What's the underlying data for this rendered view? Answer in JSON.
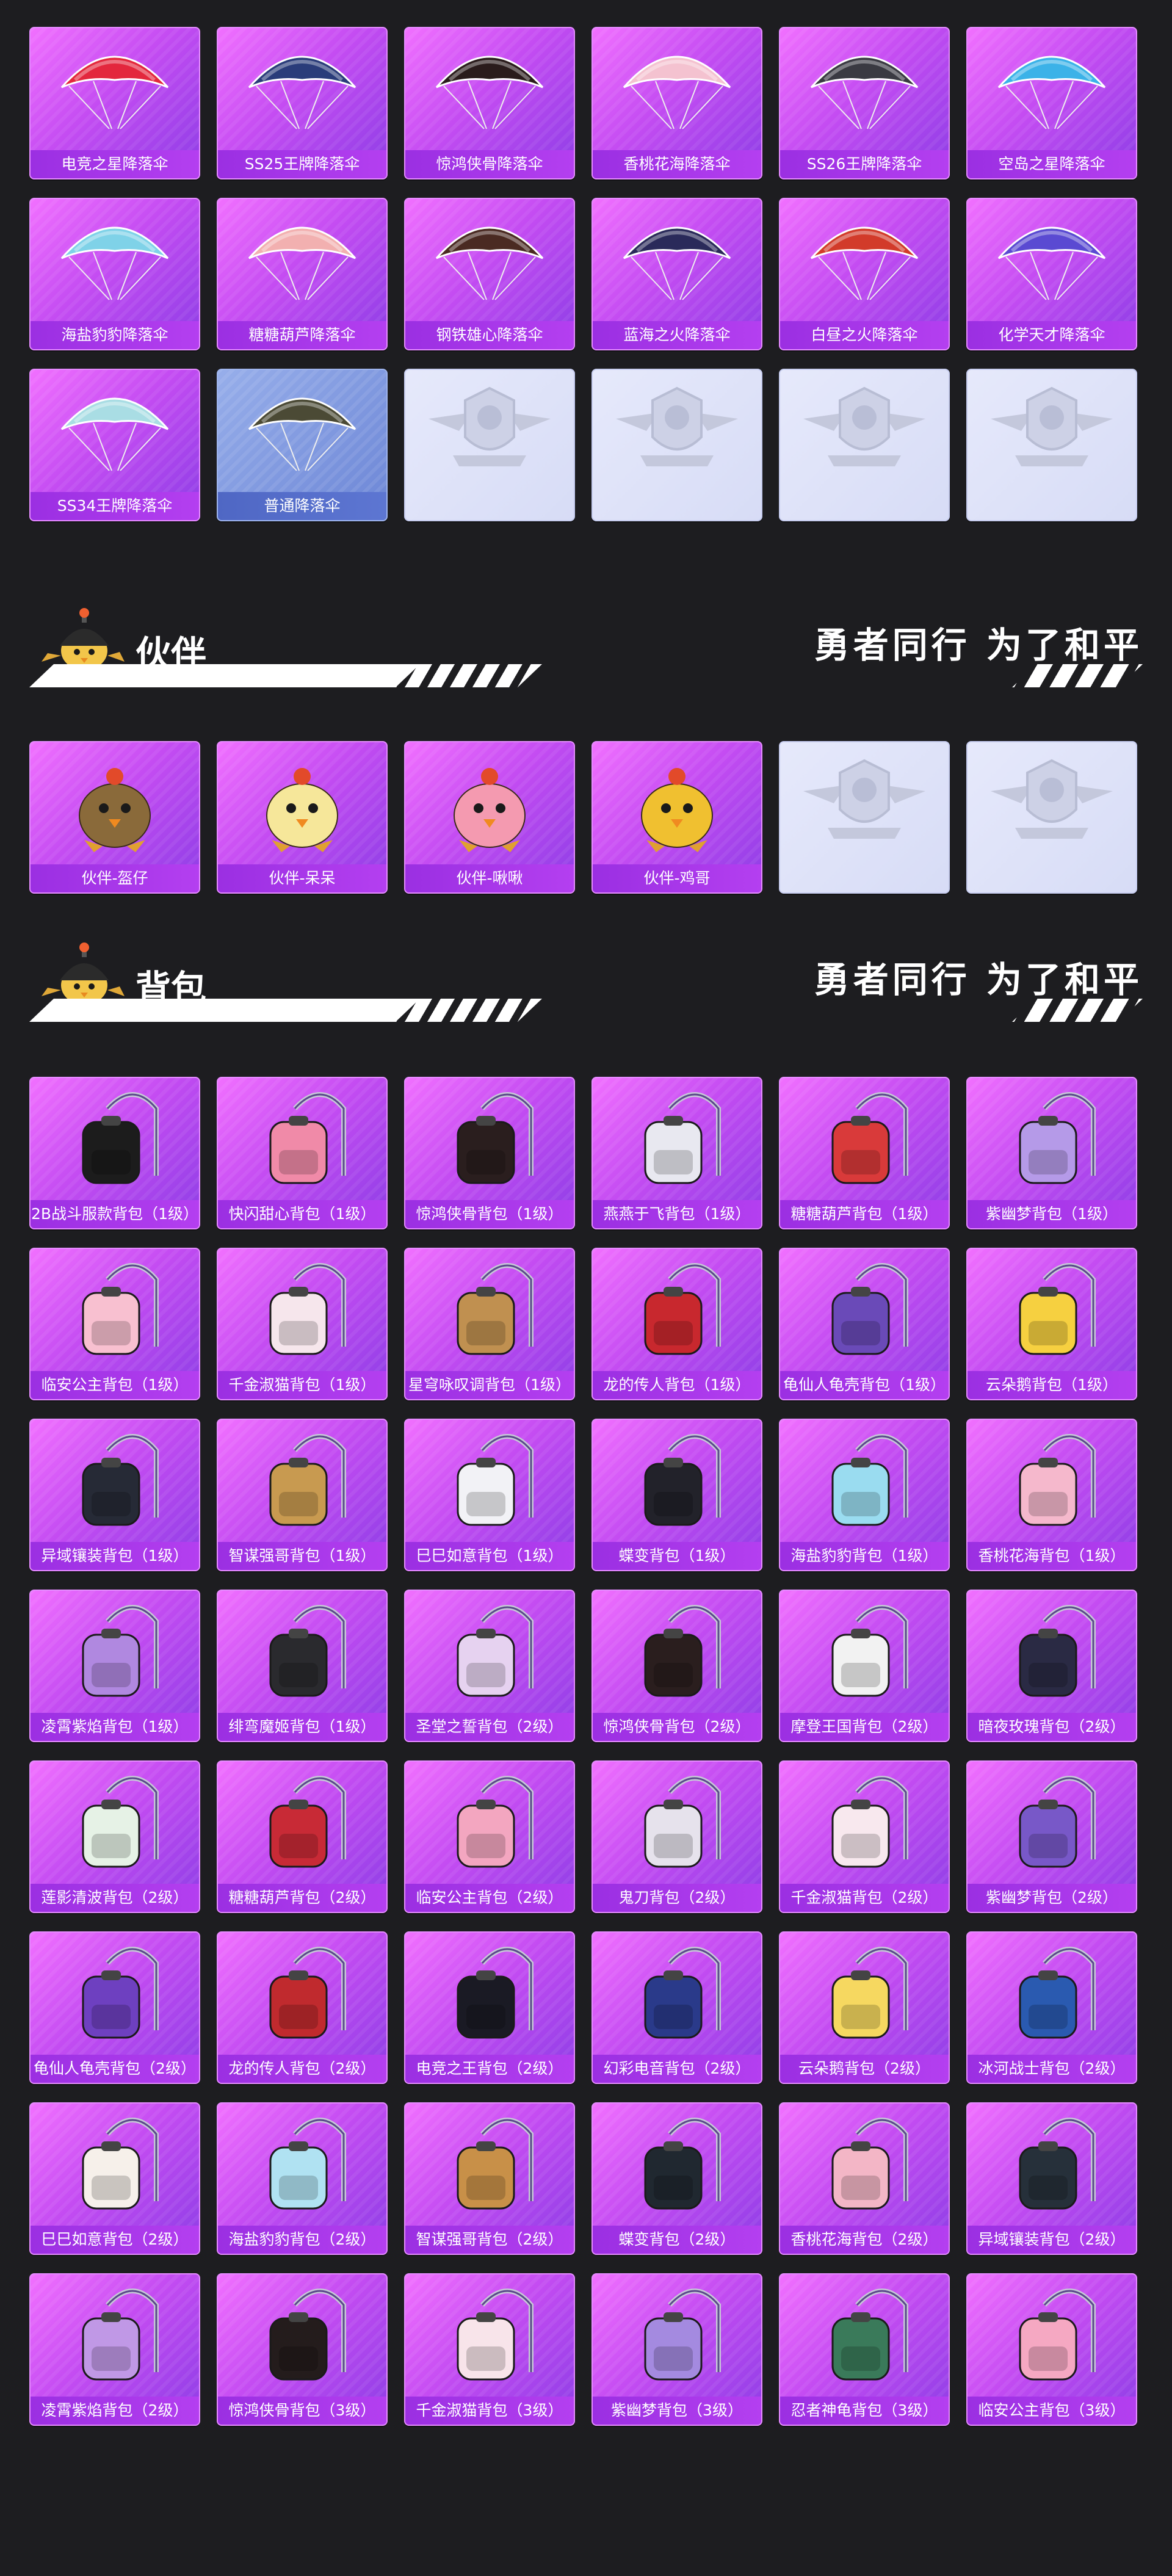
{
  "parachutes": {
    "items": [
      {
        "label": "电竞之星降落伞",
        "icon": "parachute-icon",
        "color": "#e3273d"
      },
      {
        "label": "SS25王牌降落伞",
        "icon": "parachute-icon",
        "color": "#2a3c7a"
      },
      {
        "label": "惊鸿侠骨降落伞",
        "icon": "parachute-icon",
        "color": "#2a1c1c"
      },
      {
        "label": "香桃花海降落伞",
        "icon": "parachute-icon",
        "color": "#f4c2d0"
      },
      {
        "label": "SS26王牌降落伞",
        "icon": "parachute-icon",
        "color": "#3a3a42"
      },
      {
        "label": "空岛之星降落伞",
        "icon": "parachute-icon",
        "color": "#3bb2e8"
      },
      {
        "label": "海盐豹豹降落伞",
        "icon": "parachute-icon",
        "color": "#7fd2e8"
      },
      {
        "label": "糖糖葫芦降落伞",
        "icon": "parachute-icon",
        "color": "#f2b0b0"
      },
      {
        "label": "钢铁雄心降落伞",
        "icon": "parachute-icon",
        "color": "#4a2a22"
      },
      {
        "label": "蓝海之火降落伞",
        "icon": "parachute-icon",
        "color": "#2a2a5a"
      },
      {
        "label": "白昼之火降落伞",
        "icon": "parachute-icon",
        "color": "#d23b2a"
      },
      {
        "label": "化学天才降落伞",
        "icon": "parachute-icon",
        "color": "#5a4ad2"
      },
      {
        "label": "SS34王牌降落伞",
        "icon": "parachute-icon",
        "color": "#a9dde4"
      },
      {
        "label": "普通降落伞",
        "icon": "parachute-icon",
        "color": "#4b4a35",
        "variant": "blue"
      },
      {
        "label": "",
        "icon": "pubg-emblem-icon",
        "variant": "empty"
      },
      {
        "label": "",
        "icon": "pubg-emblem-icon",
        "variant": "empty"
      },
      {
        "label": "",
        "icon": "pubg-emblem-icon",
        "variant": "empty"
      },
      {
        "label": "",
        "icon": "pubg-emblem-icon",
        "variant": "empty"
      }
    ]
  },
  "companion_section": {
    "title": "伙伴",
    "slogan": "勇者同行 为了和平",
    "mascot_icon": "helmet-chick-mascot-icon"
  },
  "companions": {
    "items": [
      {
        "label": "伙伴-盔仔",
        "icon": "companion-helmet-chick-icon",
        "color": "#8a6a3a"
      },
      {
        "label": "伙伴-呆呆",
        "icon": "companion-chick-icon",
        "color": "#f6e79a"
      },
      {
        "label": "伙伴-啾啾",
        "icon": "companion-pink-bird-icon",
        "color": "#f49ab0"
      },
      {
        "label": "伙伴-鸡哥",
        "icon": "companion-rooster-icon",
        "color": "#f0c030"
      },
      {
        "label": "",
        "icon": "pubg-emblem-icon",
        "variant": "empty"
      },
      {
        "label": "",
        "icon": "pubg-emblem-icon",
        "variant": "empty"
      }
    ]
  },
  "backpack_section": {
    "title": "背包",
    "slogan": "勇者同行 为了和平",
    "mascot_icon": "helmet-chick-mascot-icon"
  },
  "backpacks": {
    "items": [
      {
        "label": "2B战斗服款背包（1级）",
        "icon": "backpack-icon",
        "color": "#1c1c1c"
      },
      {
        "label": "快闪甜心背包（1级）",
        "icon": "backpack-icon",
        "color": "#f08aa8"
      },
      {
        "label": "惊鸿侠骨背包（1级）",
        "icon": "backpack-icon",
        "color": "#2a1e1e"
      },
      {
        "label": "燕燕于飞背包（1级）",
        "icon": "backpack-icon",
        "color": "#e8e8f0"
      },
      {
        "label": "糖糖葫芦背包（1级）",
        "icon": "backpack-icon",
        "color": "#d93a3a"
      },
      {
        "label": "紫幽梦背包（1级）",
        "icon": "backpack-icon",
        "color": "#b59ae8"
      },
      {
        "label": "临安公主背包（1级）",
        "icon": "backpack-icon",
        "color": "#f8c0d0"
      },
      {
        "label": "千金淑猫背包（1级）",
        "icon": "backpack-icon",
        "color": "#f6e6ec"
      },
      {
        "label": "星穹咏叹调背包（1级）",
        "icon": "backpack-icon",
        "color": "#c09050"
      },
      {
        "label": "龙的传人背包（1级）",
        "icon": "backpack-icon",
        "color": "#c8282e"
      },
      {
        "label": "龟仙人龟壳背包（1级）",
        "icon": "backpack-icon",
        "color": "#6a4ab8"
      },
      {
        "label": "云朵鹅背包（1级）",
        "icon": "backpack-icon",
        "color": "#f6d040"
      },
      {
        "label": "异域镶装背包（1级）",
        "icon": "backpack-icon",
        "color": "#262a36"
      },
      {
        "label": "智谋强哥背包（1级）",
        "icon": "backpack-icon",
        "color": "#c89a50"
      },
      {
        "label": "巳巳如意背包（1级）",
        "icon": "backpack-icon",
        "color": "#f2f2f6"
      },
      {
        "label": "蝶变背包（1级）",
        "icon": "backpack-icon",
        "color": "#22222a"
      },
      {
        "label": "海盐豹豹背包（1级）",
        "icon": "backpack-icon",
        "color": "#9adcf0"
      },
      {
        "label": "香桃花海背包（1级）",
        "icon": "backpack-icon",
        "color": "#f5b8cc"
      },
      {
        "label": "凌霄紫焰背包（1级）",
        "icon": "backpack-icon",
        "color": "#b088e0"
      },
      {
        "label": "绯弯魔姬背包（1级）",
        "icon": "backpack-icon",
        "color": "#2a2a2e"
      },
      {
        "label": "圣堂之誓背包（2级）",
        "icon": "backpack-icon",
        "color": "#e6d2f0"
      },
      {
        "label": "惊鸿侠骨背包（2级）",
        "icon": "backpack-icon",
        "color": "#2a1e1e"
      },
      {
        "label": "摩登王国背包（2级）",
        "icon": "backpack-icon",
        "color": "#f2f2f2"
      },
      {
        "label": "暗夜玫瑰背包（2级）",
        "icon": "backpack-icon",
        "color": "#2a2a44"
      },
      {
        "label": "莲影清波背包（2级）",
        "icon": "backpack-icon",
        "color": "#e6f2e6"
      },
      {
        "label": "糖糖葫芦背包（2级）",
        "icon": "backpack-icon",
        "color": "#c82a36"
      },
      {
        "label": "临安公主背包（2级）",
        "icon": "backpack-icon",
        "color": "#f3a6c0"
      },
      {
        "label": "鬼刀背包（2级）",
        "icon": "backpack-icon",
        "color": "#e6e2ec"
      },
      {
        "label": "千金淑猫背包（2级）",
        "icon": "backpack-icon",
        "color": "#f8e8ee"
      },
      {
        "label": "紫幽梦背包（2级）",
        "icon": "backpack-icon",
        "color": "#7858c8"
      },
      {
        "label": "龟仙人龟壳背包（2级）",
        "icon": "backpack-icon",
        "color": "#6e40c0"
      },
      {
        "label": "龙的传人背包（2级）",
        "icon": "backpack-icon",
        "color": "#c02a2e"
      },
      {
        "label": "电竞之王背包（2级）",
        "icon": "backpack-icon",
        "color": "#1a1a24"
      },
      {
        "label": "幻彩电音背包（2级）",
        "icon": "backpack-icon",
        "color": "#2a3a8a"
      },
      {
        "label": "云朵鹅背包（2级）",
        "icon": "backpack-icon",
        "color": "#f6d860"
      },
      {
        "label": "冰河战士背包（2级）",
        "icon": "backpack-icon",
        "color": "#2a5ab0"
      },
      {
        "label": "巳巳如意背包（2级）",
        "icon": "backpack-icon",
        "color": "#f6f0ea"
      },
      {
        "label": "海盐豹豹背包（2级）",
        "icon": "backpack-icon",
        "color": "#b0e2f2"
      },
      {
        "label": "智谋强哥背包（2级）",
        "icon": "backpack-icon",
        "color": "#c89048"
      },
      {
        "label": "蝶变背包（2级）",
        "icon": "backpack-icon",
        "color": "#202830"
      },
      {
        "label": "香桃花海背包（2级）",
        "icon": "backpack-icon",
        "color": "#f3b6c6"
      },
      {
        "label": "异域镶装背包（2级）",
        "icon": "backpack-icon",
        "color": "#26303a"
      },
      {
        "label": "凌霄紫焰背包（2级）",
        "icon": "backpack-icon",
        "color": "#c098e6"
      },
      {
        "label": "惊鸿侠骨背包（3级）",
        "icon": "backpack-icon",
        "color": "#241c1c"
      },
      {
        "label": "千金淑猫背包（3级）",
        "icon": "backpack-icon",
        "color": "#f8e4ea"
      },
      {
        "label": "紫幽梦背包（3级）",
        "icon": "backpack-icon",
        "color": "#a48ae0"
      },
      {
        "label": "忍者神龟背包（3级）",
        "icon": "backpack-icon",
        "color": "#3a7a5a"
      },
      {
        "label": "临安公主背包（3级）",
        "icon": "backpack-icon",
        "color": "#f5a8c2"
      }
    ]
  }
}
